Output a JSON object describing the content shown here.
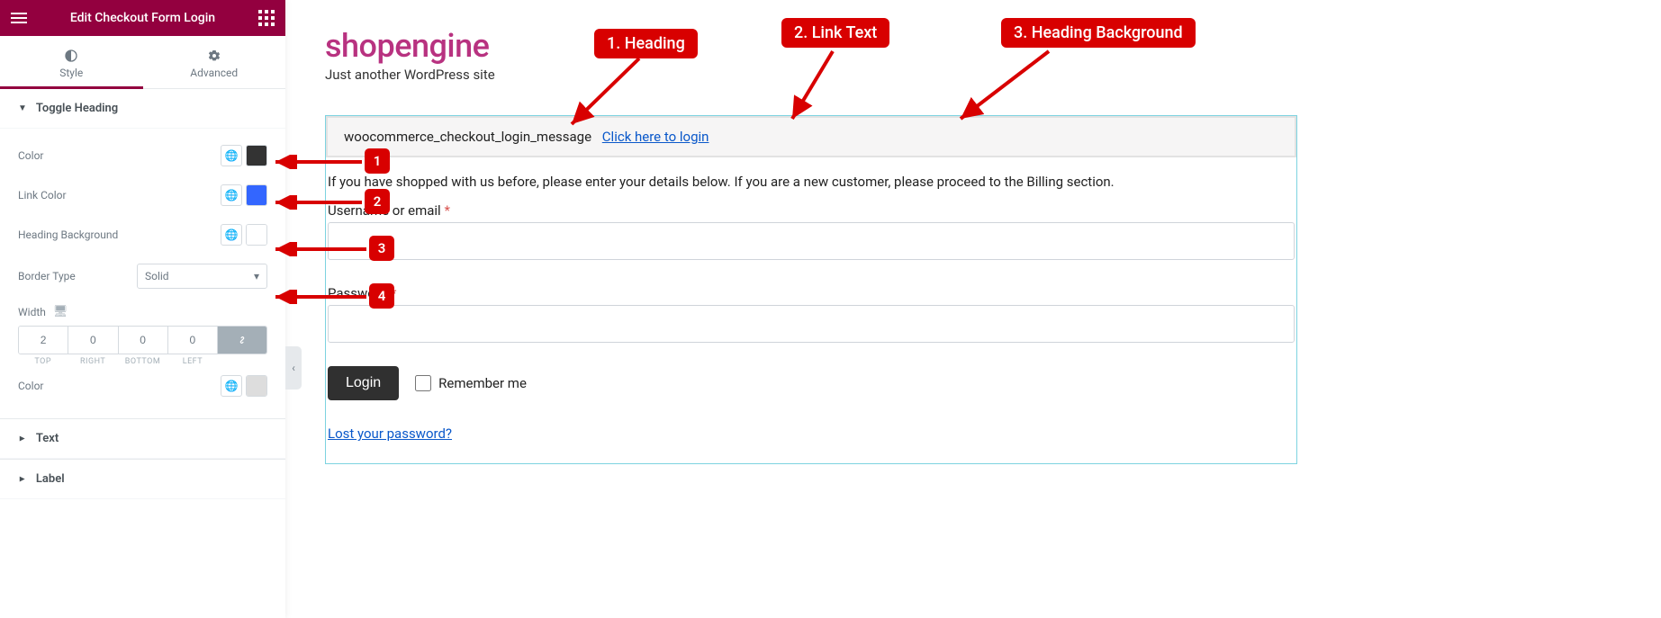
{
  "topbar": {
    "title": "Edit Checkout Form Login"
  },
  "tabs": {
    "style": "Style",
    "advanced": "Advanced"
  },
  "sections": {
    "toggle_heading": "Toggle Heading",
    "text": "Text",
    "label": "Label"
  },
  "controls": {
    "color_label": "Color",
    "color_value": "#333333",
    "link_color_label": "Link Color",
    "link_color_value": "#3366ff",
    "heading_bg_label": "Heading Background",
    "heading_bg_value": "#ffffff",
    "border_type_label": "Border Type",
    "border_type_value": "Solid",
    "width_label": "Width",
    "width": {
      "top": "2",
      "right": "0",
      "bottom": "0",
      "left": "0"
    },
    "width_sides": {
      "top": "TOP",
      "right": "RIGHT",
      "bottom": "BOTTOM",
      "left": "LEFT"
    },
    "border_color_label": "Color",
    "border_color_value": "#dddddd"
  },
  "brand": {
    "name": "shopengine",
    "tagline": "Just another WordPress site"
  },
  "notice": {
    "message": "woocommerce_checkout_login_message",
    "link": "Click here to login"
  },
  "form": {
    "desc": "If you have shopped with us before, please enter your details below. If you are a new customer, please proceed to the Billing section.",
    "username_label": "Username or email",
    "password_label": "Password",
    "required": "*",
    "login_btn": "Login",
    "remember": "Remember me",
    "lost": "Lost your password?"
  },
  "callouts": {
    "c1": "1. Heading",
    "c2": "2. Link Text",
    "c3": "3. Heading Background",
    "n1": "1",
    "n2": "2",
    "n3": "3",
    "n4": "4"
  }
}
